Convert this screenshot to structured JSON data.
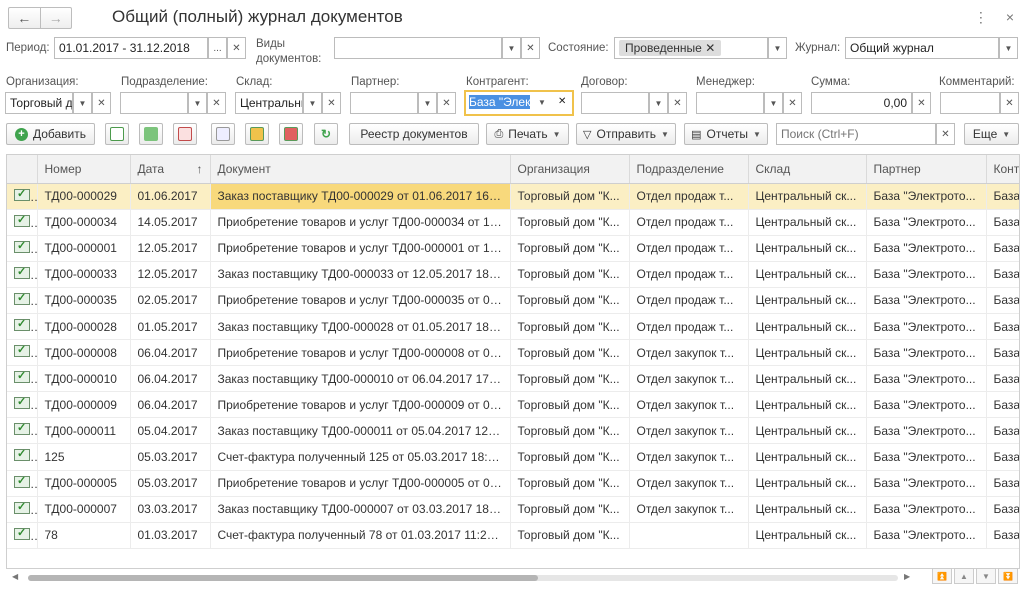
{
  "header": {
    "title": "Общий (полный) журнал документов",
    "back": "←",
    "forward": "→",
    "more": "⋮",
    "close": "×"
  },
  "filters": {
    "period_label": "Период:",
    "period_value": "01.01.2017 - 31.12.2018",
    "period_btn": "...",
    "vidy_label1": "Виды",
    "vidy_label2": "документов:",
    "vidy_value": "",
    "state_label": "Состояние:",
    "state_tag": "Проведенные",
    "journal_label": "Журнал:",
    "journal_value": "Общий журнал",
    "org_label": "Организация:",
    "org_value": "Торговый д",
    "podr_label": "Подразделение:",
    "podr_value": "",
    "sklad_label": "Склад:",
    "sklad_value": "Центральны",
    "partner_label": "Партнер:",
    "partner_value": "",
    "kontr_label": "Контрагент:",
    "kontr_value": "База \"Элек",
    "dogovor_label": "Договор:",
    "dogovor_value": "",
    "manager_label": "Менеджер:",
    "manager_value": "",
    "summa_label": "Сумма:",
    "summa_value": "0,00",
    "comment_label": "Комментарий:",
    "comment_value": ""
  },
  "toolbar": {
    "add": "Добавить",
    "registry": "Реестр документов",
    "print": "Печать",
    "send": "Отправить",
    "reports": "Отчеты",
    "search_placeholder": "Поиск (Ctrl+F)",
    "more": "Еще"
  },
  "table": {
    "columns": [
      "",
      "Номер",
      "Дата",
      "Документ",
      "Организация",
      "Подразделение",
      "Склад",
      "Партнер",
      "Контр"
    ],
    "sort_arrow": "↑",
    "rows": [
      [
        "ТД00-000029",
        "01.06.2017",
        "Заказ поставщику ТД00-000029 от 01.06.2017 16:1...",
        "Торговый дом \"К...",
        "Отдел продаж т...",
        "Центральный ск...",
        "База \"Электрото...",
        "База"
      ],
      [
        "ТД00-000034",
        "14.05.2017",
        "Приобретение товаров и услуг ТД00-000034 от 14....",
        "Торговый дом \"К...",
        "Отдел продаж т...",
        "Центральный ск...",
        "База \"Электрото...",
        "База"
      ],
      [
        "ТД00-000001",
        "12.05.2017",
        "Приобретение товаров и услуг ТД00-000001 от 12....",
        "Торговый дом \"К...",
        "Отдел продаж т...",
        "Центральный ск...",
        "База \"Электрото...",
        "База"
      ],
      [
        "ТД00-000033",
        "12.05.2017",
        "Заказ поставщику ТД00-000033 от 12.05.2017 18:1...",
        "Торговый дом \"К...",
        "Отдел продаж т...",
        "Центральный ск...",
        "База \"Электрото...",
        "База"
      ],
      [
        "ТД00-000035",
        "02.05.2017",
        "Приобретение товаров и услуг ТД00-000035 от 02....",
        "Торговый дом \"К...",
        "Отдел продаж т...",
        "Центральный ск...",
        "База \"Электрото...",
        "База"
      ],
      [
        "ТД00-000028",
        "01.05.2017",
        "Заказ поставщику ТД00-000028 от 01.05.2017 18:4...",
        "Торговый дом \"К...",
        "Отдел продаж т...",
        "Центральный ск...",
        "База \"Электрото...",
        "База"
      ],
      [
        "ТД00-000008",
        "06.04.2017",
        "Приобретение товаров и услуг ТД00-000008 от 06....",
        "Торговый дом \"К...",
        "Отдел закупок т...",
        "Центральный ск...",
        "База \"Электрото...",
        "База"
      ],
      [
        "ТД00-000010",
        "06.04.2017",
        "Заказ поставщику ТД00-000010 от 06.04.2017 17:1...",
        "Торговый дом \"К...",
        "Отдел закупок т...",
        "Центральный ск...",
        "База \"Электрото...",
        "База"
      ],
      [
        "ТД00-000009",
        "06.04.2017",
        "Приобретение товаров и услуг ТД00-000009 от 06....",
        "Торговый дом \"К...",
        "Отдел закупок т...",
        "Центральный ск...",
        "База \"Электрото...",
        "База"
      ],
      [
        "ТД00-000011",
        "05.04.2017",
        "Заказ поставщику ТД00-000011 от 05.04.2017 12:1...",
        "Торговый дом \"К...",
        "Отдел закупок т...",
        "Центральный ск...",
        "База \"Электрото...",
        "База"
      ],
      [
        "125",
        "05.03.2017",
        "Счет-фактура полученный 125 от 05.03.2017 18:12...",
        "Торговый дом \"К...",
        "Отдел закупок т...",
        "Центральный ск...",
        "База \"Электрото...",
        "База"
      ],
      [
        "ТД00-000005",
        "05.03.2017",
        "Приобретение товаров и услуг ТД00-000005 от 05....",
        "Торговый дом \"К...",
        "Отдел закупок т...",
        "Центральный ск...",
        "База \"Электрото...",
        "База"
      ],
      [
        "ТД00-000007",
        "03.03.2017",
        "Заказ поставщику ТД00-000007 от 03.03.2017 18:0...",
        "Торговый дом \"К...",
        "Отдел закупок т...",
        "Центральный ск...",
        "База \"Электрото...",
        "База"
      ],
      [
        "78",
        "01.03.2017",
        "Счет-фактура полученный 78 от 01.03.2017 11:26:38",
        "Торговый дом \"К...",
        "",
        "Центральный ск...",
        "База \"Электрото...",
        "База"
      ]
    ]
  }
}
